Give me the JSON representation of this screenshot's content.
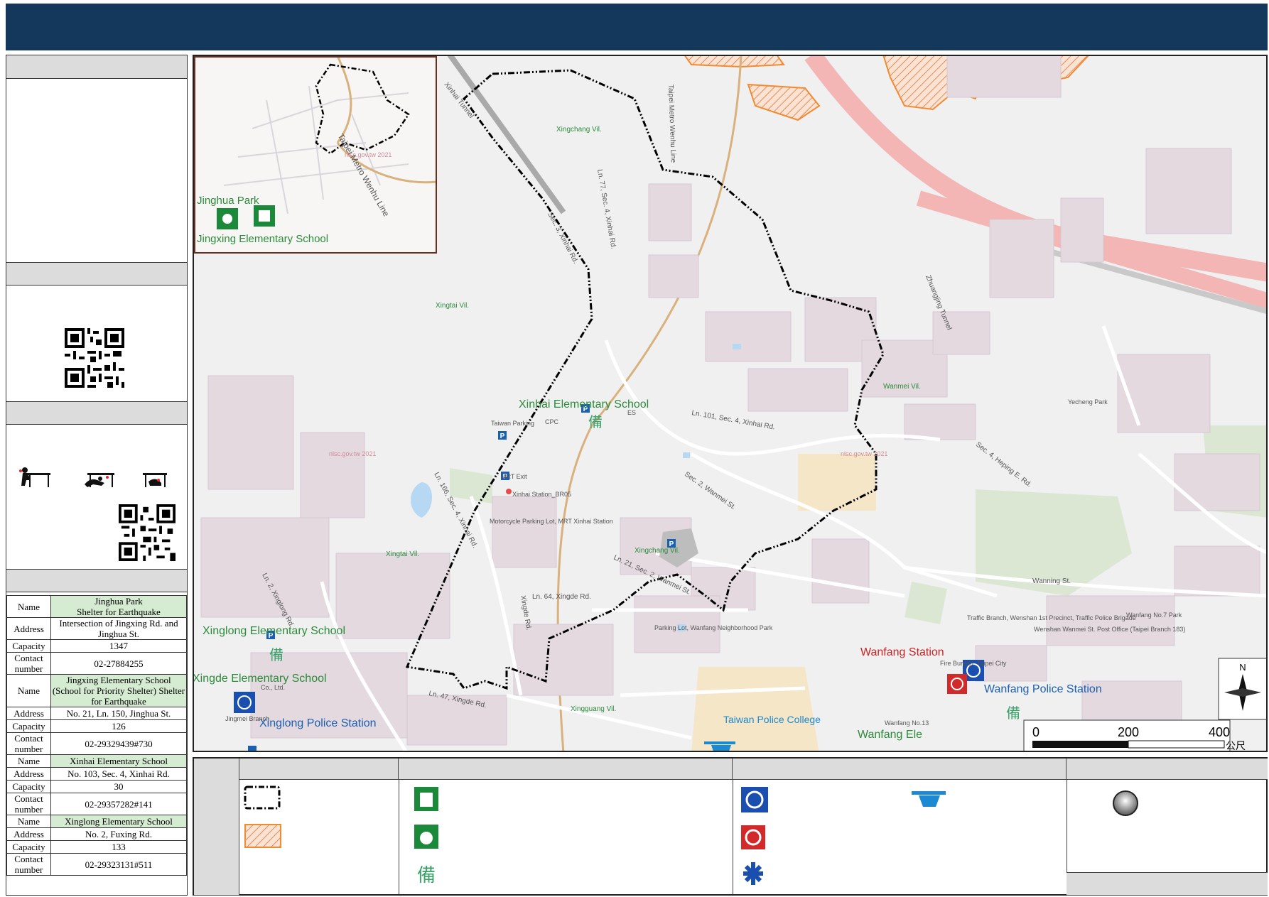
{
  "map": {
    "inset": {
      "labels": {
        "park": "Jinghua Park",
        "school": "Jingxing Elementary School",
        "line": "Taipei Metro Wenhu Line",
        "watermark": "nlsc.gov.tw 2021"
      }
    },
    "labels": {
      "xinhai_school": "Xinhai Elementary School",
      "xinglong_school": "Xinglong Elementary School",
      "xingde_school": "Xingde Elementary School",
      "xinglong_police": "Xinglong Police Station",
      "wanfang_station": "Wanfang Station",
      "wanfang_police": "Wanfang Police Station",
      "police_college": "Taiwan Police College",
      "wanfang_el": "Wanfang Ele",
      "villages": [
        "Xingchang Vil.",
        "Xingtai Vil.",
        "Xingtai Vil.",
        "Xingchang Vil.",
        "Wanmei Vil.",
        "Xingguang Vil."
      ],
      "roads": {
        "xinhai_tunnel": "Xinhai Tunnel",
        "wenhu_line": "Taipei Metro Wenhu Line",
        "sec3_xinhai": "Sec. 3, Xinhai Rd.",
        "ln77": "Ln. 77, Sec. 4, Xinhai Rd.",
        "zhuangjing": "Zhuangjing Tunnel",
        "ln101": "Ln. 101, Sec. 4, Xinhai Rd.",
        "sec2_wanmei": "Sec. 2, Wanmei St.",
        "heping": "Sec. 4, Heping E. Rd.",
        "ln166": "Ln. 166, Sec. 4, Xinhai Rd.",
        "ln21": "Ln. 21, Sec. 2, Wanmei St.",
        "ln64": "Ln. 64, Xingde Rd.",
        "xingde": "Xingde Rd.",
        "wanning": "Wanning St.",
        "ln47": "Ln. 47, Xingde Rd.",
        "fuxing": "Ln. 2, Xinglong Rd."
      },
      "pois": {
        "taiwan_parking": "Taiwan Parking",
        "mrt_exit": "MRT Exit",
        "xinhai_station": "Xinhai Station_BR05",
        "moto_parking": "Motorcycle Parking Lot, MRT Xinhai Station",
        "cpc": "CPC",
        "es": "ES",
        "yecheng": "Yecheng Park",
        "parking_lot": "Parking Lot, Wanfang Neighborhood Park",
        "traffic": "Traffic Branch, Wenshan 1st Precinct, Traffic Police Brigade",
        "fire": "Fire Bureau, Taipei City",
        "post": "Wenshan Wanmei St. Post Office (Taipei Branch 183)",
        "wanfang_park": "Wanfang No.7 Park",
        "jingmei": "Jingmei Branch",
        "co_ltd": "Co., Ltd.",
        "wanfang_no13": "Wanfang No.13",
        "watermark1": "nlsc.gov.tw 2021",
        "watermark2": "nlsc.gov.tw 2021"
      }
    },
    "scale": {
      "ticks": [
        "0",
        "200",
        "400"
      ],
      "unit": "公尺"
    },
    "north": "N"
  },
  "info_table": [
    {
      "rows": [
        [
          "Name",
          "Jinghua Park\nShelter for Earthquake"
        ],
        [
          "Address",
          "Intersection of Jingxing Rd. and Jinghua St."
        ],
        [
          "Capacity",
          "1347"
        ],
        [
          "Contact number",
          "02-27884255"
        ]
      ]
    },
    {
      "rows": [
        [
          "Name",
          "Jingxing Elementary School (School for Priority Shelter) Shelter for Earthquake"
        ],
        [
          "Address",
          "No. 21, Ln. 150, Jinghua St."
        ],
        [
          "Capacity",
          "126"
        ],
        [
          "Contact number",
          "02-29329439#730"
        ]
      ]
    },
    {
      "rows": [
        [
          "Name",
          "Xinhai Elementary School"
        ],
        [
          "Address",
          "No. 103, Sec. 4, Xinhai Rd."
        ],
        [
          "Capacity",
          "30"
        ],
        [
          "Contact number",
          "02-29357282#141"
        ]
      ]
    },
    {
      "rows": [
        [
          "Name",
          "Xinglong Elementary School"
        ],
        [
          "Address",
          "No. 2, Fuxing Rd."
        ],
        [
          "Capacity",
          "133"
        ],
        [
          "Contact number",
          "02-29323131#511"
        ]
      ]
    }
  ],
  "colors": {
    "banner": "#14375c",
    "section": "#dcdcdc",
    "highlight": "#d6ecd2",
    "boundary": "#000000",
    "hazard": "#f28a32",
    "shelter_green": "#1a8a3a",
    "police_blue": "#1a4fb0",
    "fire_red": "#d22a2a"
  }
}
